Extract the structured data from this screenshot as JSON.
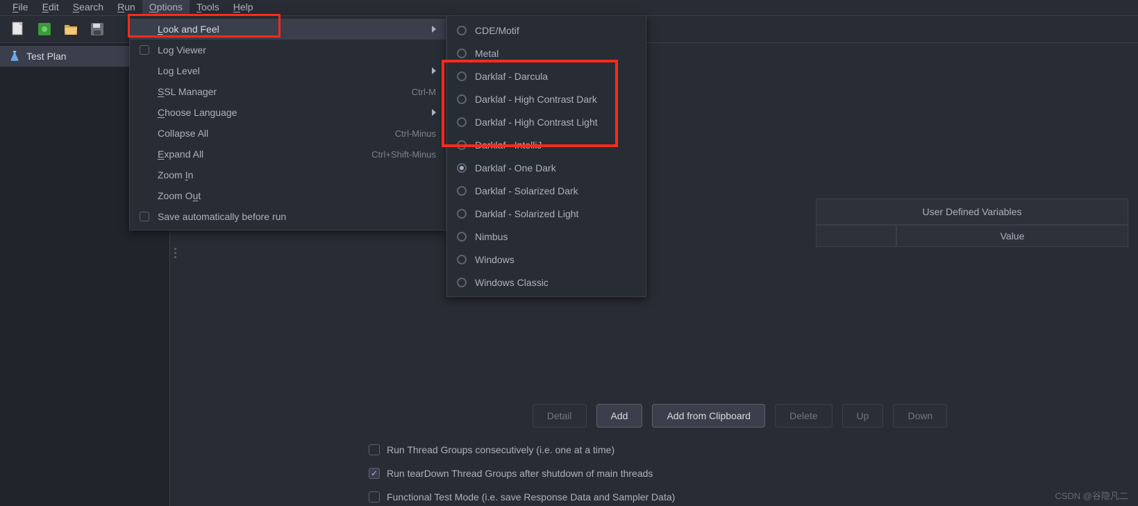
{
  "menubar": {
    "file": "File",
    "edit": "Edit",
    "search": "Search",
    "run": "Run",
    "options": "Options",
    "tools": "Tools",
    "help": "Help"
  },
  "tree": {
    "testplan": "Test Plan"
  },
  "options_menu": {
    "look_and_feel": "Look and Feel",
    "log_viewer": "Log Viewer",
    "log_level": "Log Level",
    "ssl_manager": "SSL Manager",
    "ssl_accel": "Ctrl-M",
    "choose_language": "Choose Language",
    "collapse_all": "Collapse All",
    "collapse_accel": "Ctrl-Minus",
    "expand_all": "Expand All",
    "expand_accel": "Ctrl+Shift-Minus",
    "zoom_in": "Zoom In",
    "zoom_out": "Zoom Out",
    "save_auto": "Save automatically before run"
  },
  "laf": {
    "cde": "CDE/Motif",
    "metal": "Metal",
    "darcula": "Darklaf - Darcula",
    "hcdark": "Darklaf - High Contrast Dark",
    "hclight": "Darklaf - High Contrast Light",
    "intellij": "Darklaf - IntelliJ",
    "onedark": "Darklaf - One Dark",
    "soldark": "Darklaf - Solarized Dark",
    "sollight": "Darklaf - Solarized Light",
    "nimbus": "Nimbus",
    "windows": "Windows",
    "winclassic": "Windows Classic"
  },
  "main": {
    "udv_header": "User Defined Variables",
    "value_col": "Value",
    "detail": "Detail",
    "add": "Add",
    "add_clip": "Add from Clipboard",
    "delete": "Delete",
    "up": "Up",
    "down": "Down",
    "chk1": "Run Thread Groups consecutively (i.e. one at a time)",
    "chk2": "Run tearDown Thread Groups after shutdown of main threads",
    "chk3": "Functional Test Mode (i.e. save Response Data and Sampler Data)"
  },
  "watermark": "CSDN @谷隐凡二"
}
